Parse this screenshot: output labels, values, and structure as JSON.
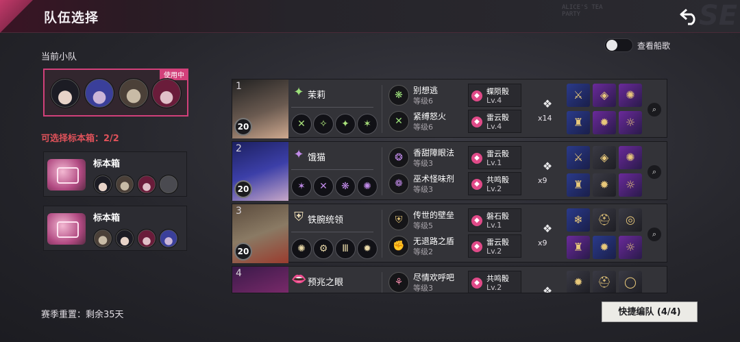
{
  "header": {
    "title": "队伍选择",
    "back_icon": "back-arrow-icon",
    "deco_text": "ALICE'S TEA\nPARTY"
  },
  "current_squad": {
    "label": "当前小队",
    "in_use": "使用中",
    "members": [
      "茉莉",
      "饿猫",
      "铁腕统领",
      "预兆之眼"
    ]
  },
  "specimen": {
    "label": "可选择标本箱：2/2",
    "boxes": [
      {
        "title": "标本箱"
      },
      {
        "title": "标本箱"
      }
    ]
  },
  "season": {
    "text": "赛季重置：剩余35天"
  },
  "toggle": {
    "label": "查看船歌",
    "on": false
  },
  "heroes": [
    {
      "index": "1",
      "level": "20",
      "name": "茉莉",
      "traits": [
        {
          "name": "别想逃",
          "level": "等级6"
        },
        {
          "name": "紧缚怒火",
          "level": "等级6"
        }
      ],
      "dice": [
        {
          "name": "蝶陨骰",
          "level": "Lv.4"
        },
        {
          "name": "雷云骰",
          "level": "Lv.4"
        }
      ],
      "rune_count": "x14"
    },
    {
      "index": "2",
      "level": "20",
      "name": "饿猫",
      "traits": [
        {
          "name": "香甜障眼法",
          "level": "等级3"
        },
        {
          "name": "巫术怪味剂",
          "level": "等级3"
        }
      ],
      "dice": [
        {
          "name": "雷云骰",
          "level": "Lv.1"
        },
        {
          "name": "共鸣骰",
          "level": "Lv.2"
        }
      ],
      "rune_count": "x9"
    },
    {
      "index": "3",
      "level": "20",
      "name": "铁腕统领",
      "traits": [
        {
          "name": "传世的壁垒",
          "level": "等级5"
        },
        {
          "name": "无退路之盾",
          "level": "等级2"
        }
      ],
      "dice": [
        {
          "name": "磐石骰",
          "level": "Lv.1"
        },
        {
          "name": "雷云骰",
          "level": "Lv.2"
        }
      ],
      "rune_count": "x9"
    },
    {
      "index": "4",
      "level": "",
      "name": "预兆之眼",
      "traits": [
        {
          "name": "尽情欢呼吧",
          "level": "等级3"
        }
      ],
      "dice": [
        {
          "name": "共鸣骰",
          "level": "Lv.2"
        }
      ],
      "rune_count": ""
    }
  ],
  "quick_edit": {
    "label": "快捷编队 (4/4)"
  },
  "colors": {
    "accent": "#d2407a",
    "warning": "#e0525a"
  }
}
